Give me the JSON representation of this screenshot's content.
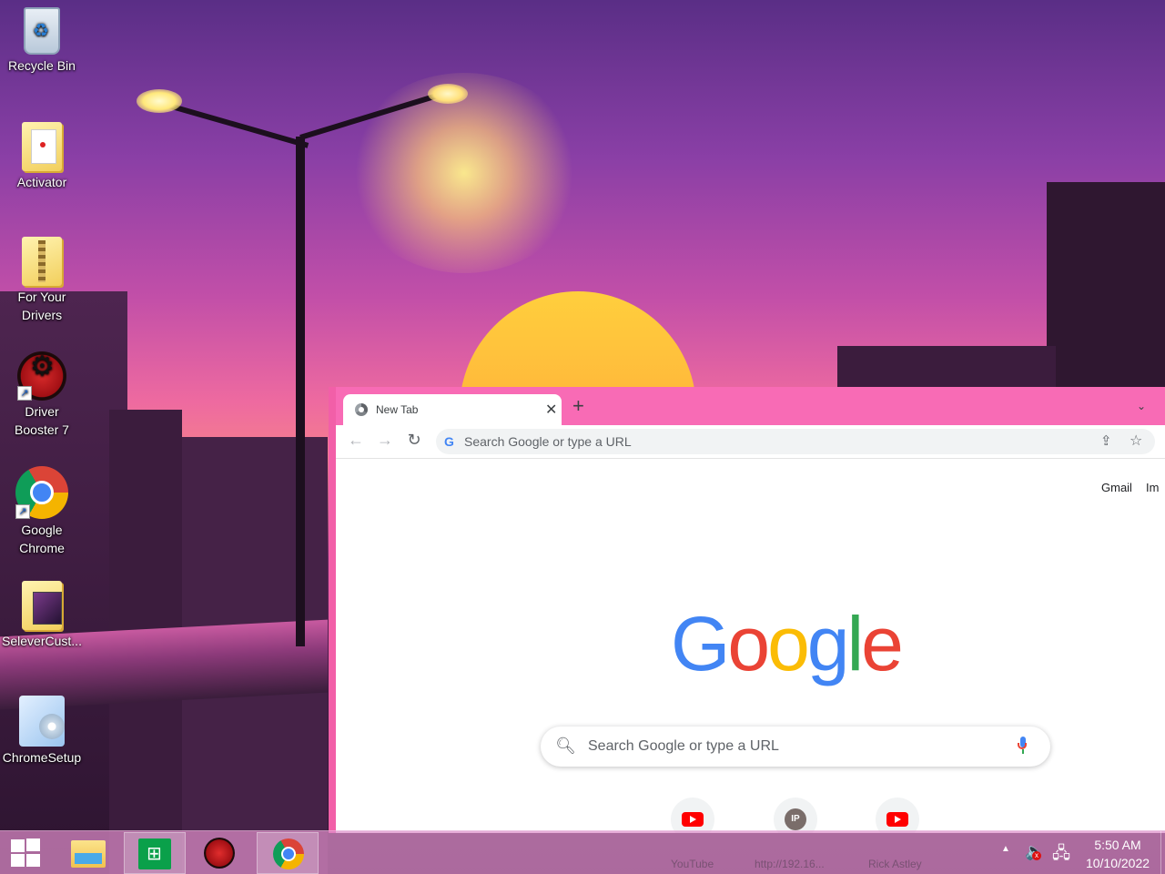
{
  "desktop": {
    "icons": [
      {
        "label": "Recycle Bin"
      },
      {
        "label": "Activator"
      },
      {
        "label": "For Your Drivers"
      },
      {
        "label": "Driver Booster 7"
      },
      {
        "label": "Google Chrome"
      },
      {
        "label": "SeleverCust..."
      },
      {
        "label": "ChromeSetup"
      }
    ]
  },
  "browser": {
    "tab": {
      "title": "New Tab",
      "close": "✕"
    },
    "new_tab": "+",
    "tab_search": "⌄",
    "toolbar": {
      "back": "←",
      "forward": "→",
      "reload": "↻",
      "omnibox_placeholder": "Search Google or type a URL",
      "omnibox_icon": "G"
    },
    "ntp": {
      "gmail": "Gmail",
      "images": "Im",
      "logo_letters": [
        "G",
        "o",
        "o",
        "g",
        "l",
        "e"
      ],
      "logo_colors": [
        "#4285f4",
        "#ea4335",
        "#fbbc05",
        "#4285f4",
        "#34a853",
        "#ea4335"
      ],
      "search_placeholder": "Search Google or type a URL",
      "shortcuts": [
        {
          "label": "YouTube",
          "icon": "youtube-icon"
        },
        {
          "label": "http://192.16...",
          "icon": "ip-icon",
          "icon_text": "IP"
        },
        {
          "label": "Rick Astley",
          "icon": "youtube-icon"
        }
      ]
    }
  },
  "taskbar": {
    "apps": [
      "start",
      "file-explorer",
      "store",
      "driver-booster",
      "chrome"
    ],
    "active_app": "chrome",
    "clock": {
      "time": "5:50 AM",
      "date": "10/10/2022"
    },
    "tray": {
      "arrow": "▲",
      "volume": "🔈",
      "volume_muted_mark": "x",
      "network": "🖧"
    }
  }
}
